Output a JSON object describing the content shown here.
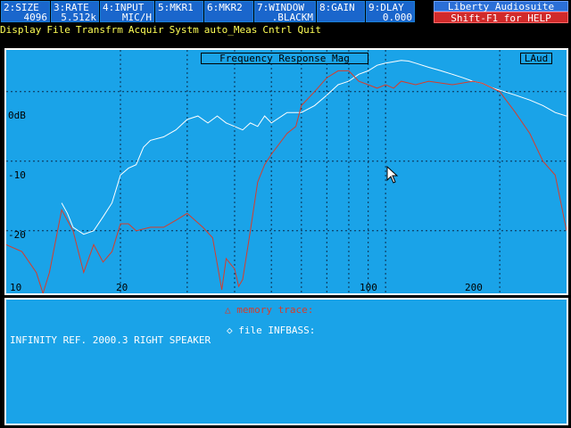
{
  "header": {
    "fkeys": [
      {
        "key": "2:SIZE",
        "value": "4096"
      },
      {
        "key": "3:RATE",
        "value": "5.512k"
      },
      {
        "key": "4:INPUT",
        "value": "MIC/H"
      },
      {
        "key": "5:MKR1",
        "value": ""
      },
      {
        "key": "6:MKR2",
        "value": ""
      },
      {
        "key": "7:WINDOW",
        "value": ".BLACKM"
      },
      {
        "key": "8:GAIN",
        "value": ""
      },
      {
        "key": "9:DLAY",
        "value": "0.000"
      }
    ],
    "brand": "Liberty Audiosuite",
    "help": "Shift-F1 for HELP"
  },
  "menu": {
    "items": [
      "Display",
      "File",
      "Transfrm",
      "Acquir",
      "Systm",
      "auto_Meas",
      "Cntrl",
      "Quit"
    ]
  },
  "plot": {
    "title": "Frequency Response Mag",
    "tag": "LAud",
    "y_labels": [
      "0dB",
      "-10",
      "-20"
    ],
    "x_labels": [
      "10",
      "20",
      "100",
      "200"
    ]
  },
  "info": {
    "memory_trace": "△ memory trace:",
    "file_line": "◇ file INFBASS:",
    "description": "INFINITY REF. 2000.3 RIGHT SPEAKER"
  },
  "colors": {
    "plot_bg": "#1aa3e8",
    "trace_current": "#ffffff",
    "trace_memory": "#d83c2a",
    "menu_text": "#ffff55",
    "help_bg": "#d12a2a"
  },
  "chart_data": {
    "type": "line",
    "title": "Frequency Response Mag",
    "x_scale": "log",
    "xlim": [
      10,
      300
    ],
    "ylim": [
      -29,
      6
    ],
    "y_ticks": [
      0,
      -10,
      -20
    ],
    "grid": true,
    "series": [
      {
        "color": "#ffffff",
        "points": [
          [
            14,
            -16
          ],
          [
            14.5,
            -17.5
          ],
          [
            15,
            -19.5
          ],
          [
            16,
            -20.5
          ],
          [
            17,
            -20
          ],
          [
            18,
            -18
          ],
          [
            19,
            -16
          ],
          [
            20,
            -12
          ],
          [
            21,
            -11
          ],
          [
            22,
            -10.5
          ],
          [
            23,
            -8
          ],
          [
            24,
            -7
          ],
          [
            26,
            -6.5
          ],
          [
            28,
            -5.5
          ],
          [
            30,
            -4
          ],
          [
            32,
            -3.5
          ],
          [
            34,
            -4.5
          ],
          [
            36,
            -3.5
          ],
          [
            38,
            -4.5
          ],
          [
            40,
            -5
          ],
          [
            42,
            -5.5
          ],
          [
            44,
            -4.5
          ],
          [
            46,
            -5
          ],
          [
            48,
            -3.5
          ],
          [
            50,
            -4.5
          ],
          [
            55,
            -3
          ],
          [
            60,
            -3
          ],
          [
            65,
            -2
          ],
          [
            70,
            -0.5
          ],
          [
            75,
            1
          ],
          [
            80,
            1.5
          ],
          [
            85,
            2.5
          ],
          [
            90,
            3
          ],
          [
            95,
            3.8
          ],
          [
            100,
            4.1
          ],
          [
            105,
            4.3
          ],
          [
            110,
            4.5
          ],
          [
            115,
            4.4
          ],
          [
            120,
            4.1
          ],
          [
            130,
            3.5
          ],
          [
            140,
            3
          ],
          [
            150,
            2.5
          ],
          [
            160,
            2
          ],
          [
            170,
            1.5
          ],
          [
            180,
            1.2
          ],
          [
            190,
            0.6
          ],
          [
            200,
            0.2
          ],
          [
            220,
            -0.5
          ],
          [
            240,
            -1.2
          ],
          [
            260,
            -2
          ],
          [
            280,
            -3
          ],
          [
            300,
            -3.5
          ]
        ]
      },
      {
        "color": "#d83c2a",
        "points": [
          [
            10,
            -22
          ],
          [
            11,
            -23
          ],
          [
            12,
            -26
          ],
          [
            12.5,
            -29
          ],
          [
            13,
            -26
          ],
          [
            14,
            -17
          ],
          [
            15,
            -20
          ],
          [
            16,
            -26
          ],
          [
            17,
            -22
          ],
          [
            18,
            -24.5
          ],
          [
            19,
            -23
          ],
          [
            20,
            -19
          ],
          [
            21,
            -19
          ],
          [
            22,
            -20
          ],
          [
            24,
            -19.5
          ],
          [
            26,
            -19.5
          ],
          [
            28,
            -18.5
          ],
          [
            30,
            -17.5
          ],
          [
            33,
            -19.5
          ],
          [
            35,
            -21
          ],
          [
            37,
            -28.5
          ],
          [
            38,
            -24
          ],
          [
            40,
            -25.5
          ],
          [
            41,
            -28
          ],
          [
            42,
            -27
          ],
          [
            44,
            -20
          ],
          [
            46,
            -13
          ],
          [
            48,
            -10.5
          ],
          [
            50,
            -9
          ],
          [
            55,
            -6
          ],
          [
            58,
            -5
          ],
          [
            60,
            -2
          ],
          [
            65,
            0
          ],
          [
            70,
            2
          ],
          [
            75,
            3
          ],
          [
            80,
            3
          ],
          [
            85,
            1.5
          ],
          [
            90,
            1
          ],
          [
            95,
            0.5
          ],
          [
            100,
            1
          ],
          [
            105,
            0.5
          ],
          [
            110,
            1.5
          ],
          [
            120,
            1
          ],
          [
            130,
            1.5
          ],
          [
            150,
            1
          ],
          [
            170,
            1.5
          ],
          [
            180,
            1.2
          ],
          [
            200,
            0
          ],
          [
            220,
            -3
          ],
          [
            240,
            -6
          ],
          [
            260,
            -10
          ],
          [
            280,
            -12
          ],
          [
            290,
            -16
          ],
          [
            300,
            -20
          ]
        ]
      }
    ]
  }
}
